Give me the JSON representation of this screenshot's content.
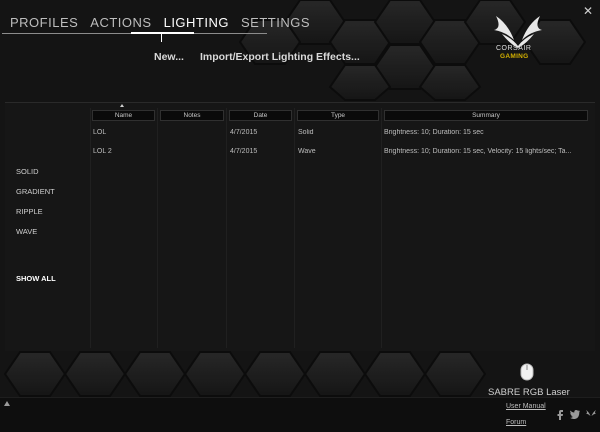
{
  "window": {
    "close_label": "✕"
  },
  "tabs": [
    {
      "label": "PROFILES",
      "active": false
    },
    {
      "label": "ACTIONS",
      "active": false
    },
    {
      "label": "LIGHTING",
      "active": true
    },
    {
      "label": "SETTINGS",
      "active": false
    }
  ],
  "subnav": {
    "new_label": "New...",
    "import_export_label": "Import/Export Lighting Effects..."
  },
  "brand": {
    "line1": "CORSAIR",
    "line2": "GAMING",
    "accent": "#d4b100"
  },
  "sidebar": {
    "items": [
      "SOLID",
      "GRADIENT",
      "RIPPLE",
      "WAVE"
    ],
    "show_all": "SHOW ALL"
  },
  "table": {
    "headers": {
      "name": "Name",
      "notes": "Notes",
      "date": "Date",
      "type": "Type",
      "summary": "Summary"
    },
    "rows": [
      {
        "name": "LOL",
        "notes": "",
        "date": "4/7/2015",
        "type": "Solid",
        "summary": "Brightness: 10; Duration: 15 sec"
      },
      {
        "name": "LOL 2",
        "notes": "",
        "date": "4/7/2015",
        "type": "Wave",
        "summary": "Brightness: 10; Duration: 15 sec, Velocity: 15 lights/sec; Ta..."
      }
    ]
  },
  "device": {
    "name": "SABRE RGB Laser",
    "icon": "mouse-icon"
  },
  "footer": {
    "user_manual": "User Manual",
    "forum": "Forum",
    "icons": [
      "facebook-icon",
      "twitter-icon",
      "corsair-icon"
    ]
  }
}
